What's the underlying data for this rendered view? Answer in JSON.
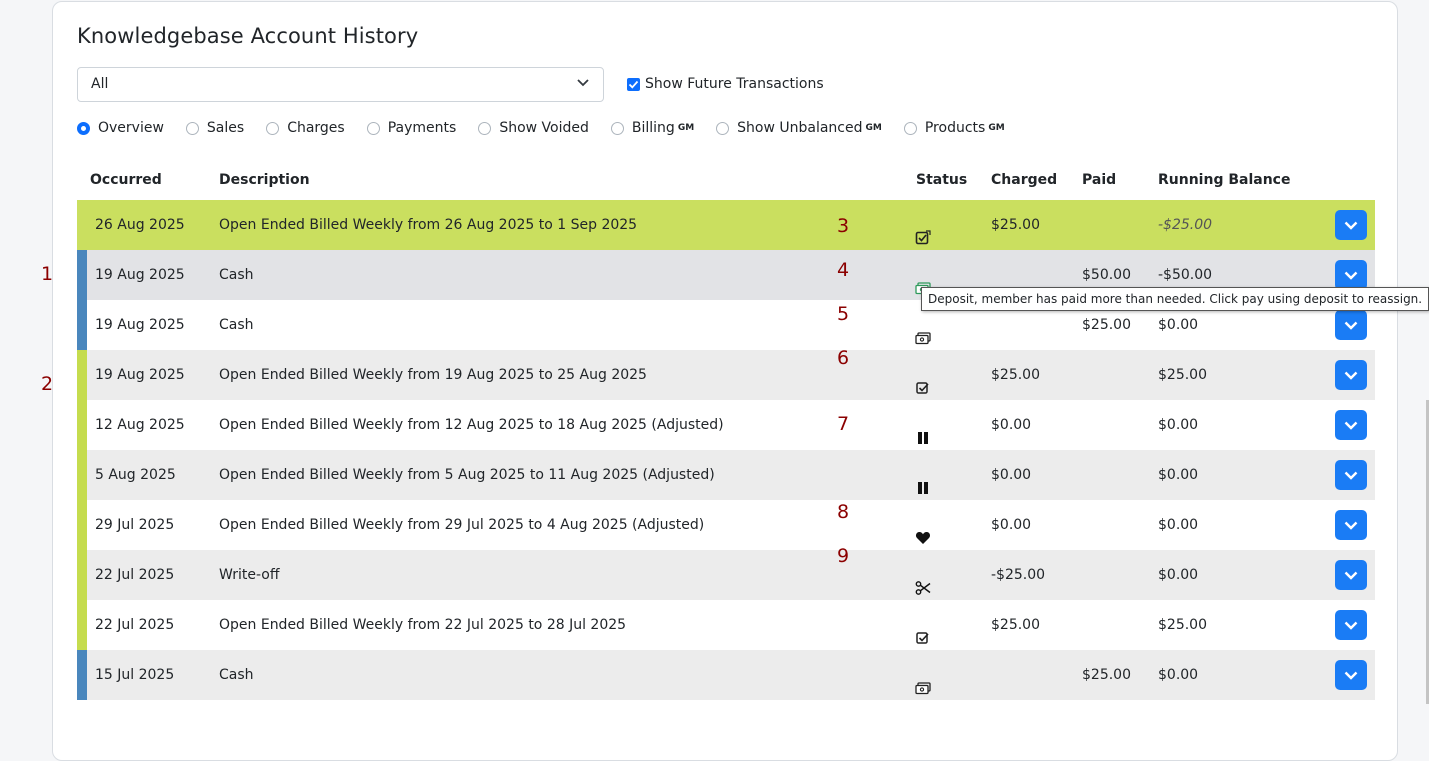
{
  "page": {
    "title": "Knowledgebase Account History"
  },
  "filter": {
    "selected": "All"
  },
  "future": {
    "label": "Show Future Transactions",
    "checked": true
  },
  "radios": [
    {
      "label": "Overview",
      "gm": "",
      "selected": true
    },
    {
      "label": "Sales",
      "gm": "",
      "selected": false
    },
    {
      "label": "Charges",
      "gm": "",
      "selected": false
    },
    {
      "label": "Payments",
      "gm": "",
      "selected": false
    },
    {
      "label": "Show Voided",
      "gm": "",
      "selected": false
    },
    {
      "label": "Billing",
      "gm": "GM",
      "selected": false
    },
    {
      "label": "Show Unbalanced",
      "gm": "GM",
      "selected": false
    },
    {
      "label": "Products",
      "gm": "GM",
      "selected": false
    }
  ],
  "table": {
    "headers": {
      "occurred": "Occurred",
      "description": "Description",
      "status": "Status",
      "charged": "Charged",
      "paid": "Paid",
      "balance": "Running Balance"
    },
    "rows": [
      {
        "occurred": "26 Aug 2025",
        "description": "Open Ended Billed Weekly from 26 Aug 2025 to 1 Sep 2025",
        "status_icon": "edit-check-icon",
        "charged": "$25.00",
        "paid": "",
        "balance": "-$25.00",
        "bar": "#cadf5f",
        "bg": "#cadf5f",
        "italic": true
      },
      {
        "occurred": "19 Aug 2025",
        "description": "Cash",
        "status_icon": "cash-deposit-icon",
        "charged": "",
        "paid": "$50.00",
        "balance": "-$50.00",
        "bar": "#4a87bd",
        "bg": "#e2e3e6"
      },
      {
        "occurred": "19 Aug 2025",
        "description": "Cash",
        "status_icon": "cash-icon",
        "charged": "",
        "paid": "$25.00",
        "balance": "$0.00",
        "bar": "#4a87bd",
        "bg": "#ffffff"
      },
      {
        "occurred": "19 Aug 2025",
        "description": "Open Ended Billed Weekly from 19 Aug 2025 to 25 Aug 2025",
        "status_icon": "check-square-icon",
        "charged": "$25.00",
        "paid": "",
        "balance": "$25.00",
        "bar": "#c5dc4e",
        "bg": "#ececec"
      },
      {
        "occurred": "12 Aug 2025",
        "description": "Open Ended Billed Weekly from 12 Aug 2025 to 18 Aug 2025 (Adjusted)",
        "status_icon": "pause-icon",
        "charged": "$0.00",
        "paid": "",
        "balance": "$0.00",
        "bar": "#c5dc4e",
        "bg": "#ffffff"
      },
      {
        "occurred": "5 Aug 2025",
        "description": "Open Ended Billed Weekly from 5 Aug 2025 to 11 Aug 2025 (Adjusted)",
        "status_icon": "pause-icon",
        "charged": "$0.00",
        "paid": "",
        "balance": "$0.00",
        "bar": "#c5dc4e",
        "bg": "#ececec"
      },
      {
        "occurred": "29 Jul 2025",
        "description": "Open Ended Billed Weekly from 29 Jul 2025 to 4 Aug 2025 (Adjusted)",
        "status_icon": "heart-icon",
        "charged": "$0.00",
        "paid": "",
        "balance": "$0.00",
        "bar": "#c5dc4e",
        "bg": "#ffffff"
      },
      {
        "occurred": "22 Jul 2025",
        "description": "Write-off",
        "status_icon": "scissors-icon",
        "charged": "-$25.00",
        "paid": "",
        "balance": "$0.00",
        "bar": "#c5dc4e",
        "bg": "#ececec"
      },
      {
        "occurred": "22 Jul 2025",
        "description": "Open Ended Billed Weekly from 22 Jul 2025 to 28 Jul 2025",
        "status_icon": "check-square-icon",
        "charged": "$25.00",
        "paid": "",
        "balance": "$25.00",
        "bar": "#c5dc4e",
        "bg": "#ffffff"
      },
      {
        "occurred": "15 Jul 2025",
        "description": "Cash",
        "status_icon": "cash-icon",
        "charged": "",
        "paid": "$25.00",
        "balance": "$0.00",
        "bar": "#4a87bd",
        "bg": "#ececec"
      }
    ]
  },
  "tooltip": {
    "text": "Deposit, member has paid more than needed. Click pay using deposit to reassign."
  },
  "annotations": [
    "1",
    "2",
    "3",
    "4",
    "5",
    "6",
    "7",
    "8",
    "9"
  ]
}
